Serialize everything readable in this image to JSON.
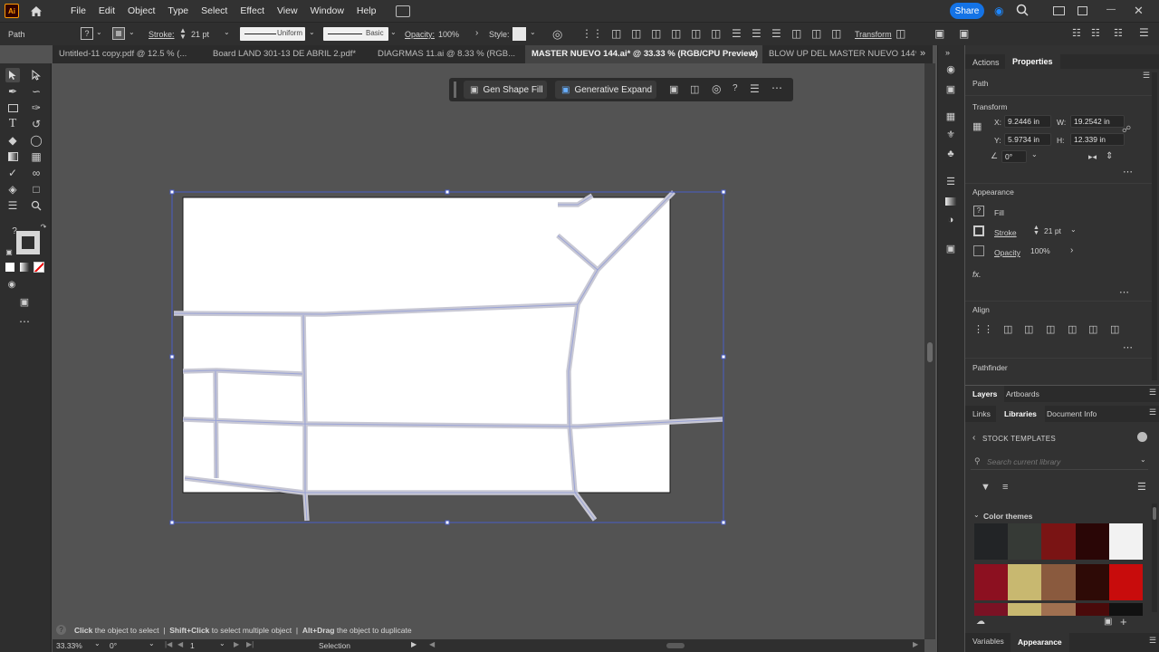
{
  "menubar": {
    "logo": "Ai",
    "items": [
      "File",
      "Edit",
      "Object",
      "Type",
      "Select",
      "Effect",
      "View",
      "Window",
      "Help"
    ],
    "share_label": "Share"
  },
  "control": {
    "path_label": "Path",
    "stroke_label": "Stroke:",
    "stroke_value": "21 pt",
    "uniform_label": "Uniform",
    "basic_label": "Basic",
    "opacity_label": "Opacity:",
    "opacity_value": "100%",
    "style_label": "Style:",
    "transform_label": "Transform"
  },
  "tabs": [
    {
      "label": "Untitled-11 copy.pdf @ 12.5 % (..."
    },
    {
      "label": "Board LAND 301-13 DE ABRIL 2.pdf*"
    },
    {
      "label": "DIAGRMAS 11.ai @ 8.33 % (RGB..."
    },
    {
      "label": "MASTER NUEVO 144.ai* @ 33.33 % (RGB/CPU Preview)"
    },
    {
      "label": "BLOW UP DEL MASTER NUEVO 144*"
    }
  ],
  "contextbar": {
    "gen_shape_fill": "Gen Shape Fill",
    "generative_expand": "Generative Expand"
  },
  "panel": {
    "tab_actions": "Actions",
    "tab_properties": "Properties",
    "path_label": "Path",
    "transform_label": "Transform",
    "x_label": "X:",
    "x_value": "9.2446 in",
    "w_label": "W:",
    "w_value": "19.2542 in",
    "y_label": "Y:",
    "y_value": "5.9734 in",
    "h_label": "H:",
    "h_value": "12.339 in",
    "angle_value": "0°",
    "appearance_label": "Appearance",
    "fill_label": "Fill",
    "stroke_label": "Stroke",
    "stroke_value": "21 pt",
    "opacity_label": "Opacity",
    "opacity_value": "100%",
    "fx_label": "fx.",
    "align_label": "Align",
    "pathfinder_label": "Pathfinder"
  },
  "libraries": {
    "tab_layers": "Layers",
    "tab_artboards": "Artboards",
    "tab_links": "Links",
    "tab_libraries": "Libraries",
    "tab_docinfo": "Document Info",
    "stock_templates": "STOCK TEMPLATES",
    "search_placeholder": "Search current library",
    "color_themes": "Color themes",
    "theme_row1": [
      "#222426",
      "#363a36",
      "#7a1414",
      "#2a0606",
      "#f2f2f2"
    ],
    "theme_row2": [
      "#8c1020",
      "#c8b870",
      "#8a5a3e",
      "#2e0a06",
      "#c80c0c"
    ],
    "theme_row3": [
      "#7a1224",
      "#c8b870",
      "#a07050",
      "#4a0a0a",
      "#111111"
    ],
    "bottom_tab_variables": "Variables",
    "bottom_tab_appearance": "Appearance"
  },
  "status": {
    "hint_1_bold": "Click",
    "hint_1_text": "the object to select",
    "hint_2_bold": "Shift+Click",
    "hint_2_text": "to select multiple object",
    "hint_3_bold": "Alt+Drag",
    "hint_3_text": "the object to duplicate",
    "zoom": "33.33%",
    "rotation": "0°",
    "artboard_num": "1",
    "tool_name": "Selection"
  },
  "colors": {
    "accent": "#1473e6",
    "selection": "#4a5cc6",
    "road_fill": "#c8c8d4"
  }
}
